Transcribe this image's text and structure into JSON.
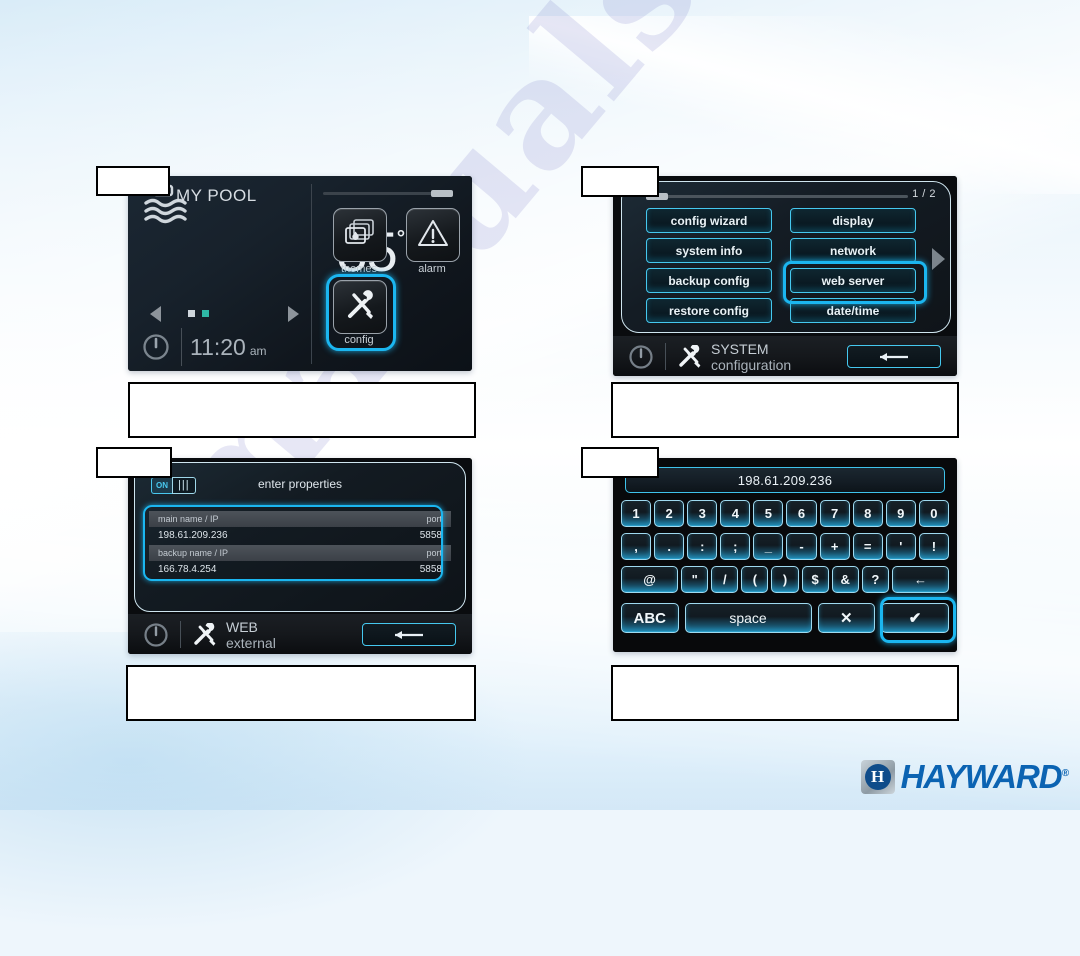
{
  "document": {
    "watermark": "manualshive.com",
    "brand": {
      "name": "HAYWARD",
      "mark_letter": "H",
      "registered": "®"
    }
  },
  "panels": [
    {
      "id": "pool-home",
      "tag_label": "",
      "caption_text": "",
      "header_title": "MY POOL",
      "temperature": "85",
      "temperature_unit": "°F",
      "clock_time": "11:20",
      "clock_meridiem": "am",
      "page_dots": 2,
      "tiles": [
        {
          "name": "themes",
          "icon": "themes-icon"
        },
        {
          "name": "alarm",
          "icon": "alarm-icon"
        },
        {
          "name": "config",
          "icon": "config-tools-icon",
          "highlighted": true
        }
      ],
      "icons": {
        "water": "water-waves-icon",
        "power": "power-icon"
      }
    },
    {
      "id": "system-configuration",
      "tag_label": "",
      "caption_text": "",
      "page_indicator": "1 / 2",
      "buttons_left": [
        "config wizard",
        "system info",
        "backup config",
        "restore config"
      ],
      "buttons_right": [
        "display",
        "network",
        "web server",
        "date/time"
      ],
      "highlighted_button": "web server",
      "footer": {
        "title_line1": "SYSTEM",
        "title_line2": "configuration",
        "back_arrow": "←"
      }
    },
    {
      "id": "web-external-properties",
      "tag_label": "",
      "caption_text": "",
      "screen_title": "enter properties",
      "toggle": {
        "state": "ON",
        "grip": "|||"
      },
      "rows": [
        {
          "label": "main name / IP",
          "port_label": "port",
          "value": "198.61.209.236",
          "port": "5858"
        },
        {
          "label": "backup name / IP",
          "port_label": "port",
          "value": "166.78.4.254",
          "port": "5858"
        }
      ],
      "footer": {
        "title_line1": "WEB",
        "title_line2": "external",
        "back_arrow": "←"
      }
    },
    {
      "id": "numeric-keypad",
      "tag_label": "",
      "caption_text": "",
      "display_value": "198.61.209.236",
      "rows": [
        [
          "1",
          "2",
          "3",
          "4",
          "5",
          "6",
          "7",
          "8",
          "9",
          "0"
        ],
        [
          ",",
          ".",
          ":",
          ";",
          "_",
          "-",
          "+",
          "=",
          "'",
          "!"
        ],
        [
          "@",
          "\"",
          "/",
          "(",
          ")",
          "$",
          "&",
          "?",
          "←"
        ]
      ],
      "bottom_row": [
        {
          "label": "ABC",
          "name": "abc-key"
        },
        {
          "label": "space",
          "name": "space-key"
        },
        {
          "label": "✕",
          "name": "cancel-key"
        },
        {
          "label": "✔",
          "name": "confirm-key",
          "highlighted": true
        }
      ]
    }
  ],
  "colors": {
    "accent_cyan": "#1bb6f0",
    "key_cyan": "#45c8ef",
    "brand_blue": "#0b63b2",
    "panel_dark": "#0a0c0f"
  }
}
